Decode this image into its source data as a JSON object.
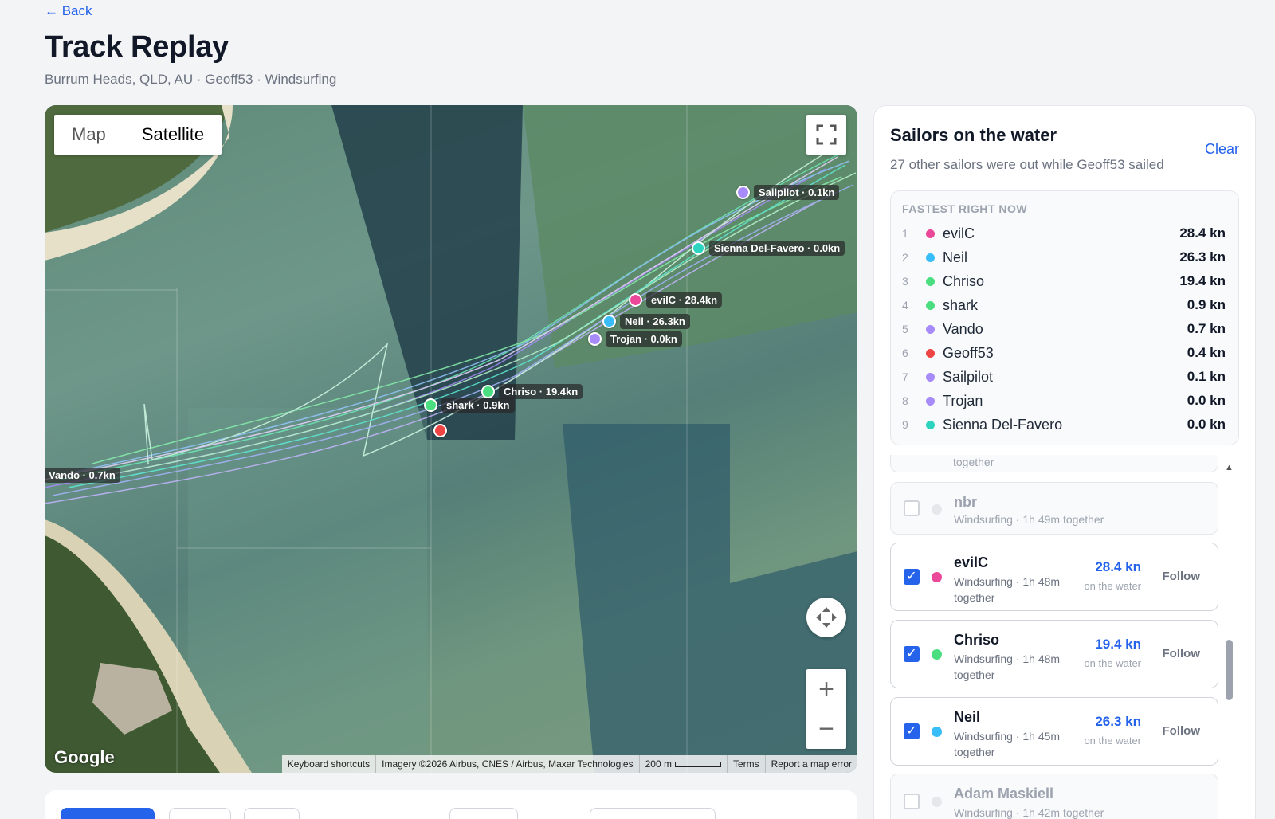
{
  "header": {
    "back_label": "← Back",
    "title": "Track Replay",
    "subtitle": "Burrum Heads, QLD, AU · Geoff53 · Windsurfing"
  },
  "map": {
    "type_map": "Map",
    "type_satellite": "Satellite",
    "active_type": "Satellite",
    "google": "Google",
    "attribution": {
      "shortcuts": "Keyboard shortcuts",
      "imagery": "Imagery ©2026 Airbus, CNES / Airbus, Maxar Technologies",
      "scale": "200 m",
      "terms": "Terms",
      "report": "Report a map error"
    },
    "markers": [
      {
        "label": "Sailpilot · 0.1kn",
        "color": "#a78bfa"
      },
      {
        "label": "Sienna Del-Favero · 0.0kn",
        "color": "#5eead4"
      },
      {
        "label": "evilC · 28.4kn",
        "color": "#f472b6"
      },
      {
        "label": "Neil · 26.3kn",
        "color": "#38bdf8"
      },
      {
        "label": "Trojan · 0.0kn",
        "color": "#c4b5fd"
      },
      {
        "label": "Chriso · 19.4kn",
        "color": "#6ee7b7"
      },
      {
        "label": "shark · 0.9kn",
        "color": "#4ade80"
      },
      {
        "label": "Geoff53",
        "color": "#ef4444"
      },
      {
        "label": "Vando · 0.7kn",
        "color": "#a78bfa"
      }
    ]
  },
  "sidebar": {
    "title": "Sailors on the water",
    "clear": "Clear",
    "subtitle": "27 other sailors were out while Geoff53 sailed",
    "fastest_heading": "FASTEST RIGHT NOW",
    "fastest": [
      {
        "rank": "1",
        "name": "evilC",
        "speed": "28.4 kn",
        "color": "#ec4899"
      },
      {
        "rank": "2",
        "name": "Neil",
        "speed": "26.3 kn",
        "color": "#38bdf8"
      },
      {
        "rank": "3",
        "name": "Chriso",
        "speed": "19.4 kn",
        "color": "#4ade80"
      },
      {
        "rank": "4",
        "name": "shark",
        "speed": "0.9 kn",
        "color": "#4ade80"
      },
      {
        "rank": "5",
        "name": "Vando",
        "speed": "0.7 kn",
        "color": "#a78bfa"
      },
      {
        "rank": "6",
        "name": "Geoff53",
        "speed": "0.4 kn",
        "color": "#ef4444"
      },
      {
        "rank": "7",
        "name": "Sailpilot",
        "speed": "0.1 kn",
        "color": "#a78bfa"
      },
      {
        "rank": "8",
        "name": "Trojan",
        "speed": "0.0 kn",
        "color": "#a78bfa"
      },
      {
        "rank": "9",
        "name": "Sienna Del-Favero",
        "speed": "0.0 kn",
        "color": "#2dd4bf"
      }
    ],
    "cards": [
      {
        "name": "",
        "meta": "together",
        "checked": false,
        "dim": true
      },
      {
        "name": "nbr",
        "meta": "Windsurfing · 1h 49m together",
        "checked": false,
        "dim": true,
        "color": "#e5e7eb"
      },
      {
        "name": "evilC",
        "meta": "Windsurfing · 1h 48m together",
        "speed": "28.4 kn",
        "sub": "on the water",
        "follow": "Follow",
        "checked": true,
        "color": "#ec4899"
      },
      {
        "name": "Chriso",
        "meta": "Windsurfing · 1h 48m together",
        "speed": "19.4 kn",
        "sub": "on the water",
        "follow": "Follow",
        "checked": true,
        "color": "#4ade80"
      },
      {
        "name": "Neil",
        "meta": "Windsurfing · 1h 45m together",
        "speed": "26.3 kn",
        "sub": "on the water",
        "follow": "Follow",
        "checked": true,
        "color": "#38bdf8"
      },
      {
        "name": "Adam Maskiell",
        "meta": "Windsurfing · 1h 42m together",
        "checked": false,
        "dim": true,
        "color": "#e5e7eb"
      }
    ]
  }
}
